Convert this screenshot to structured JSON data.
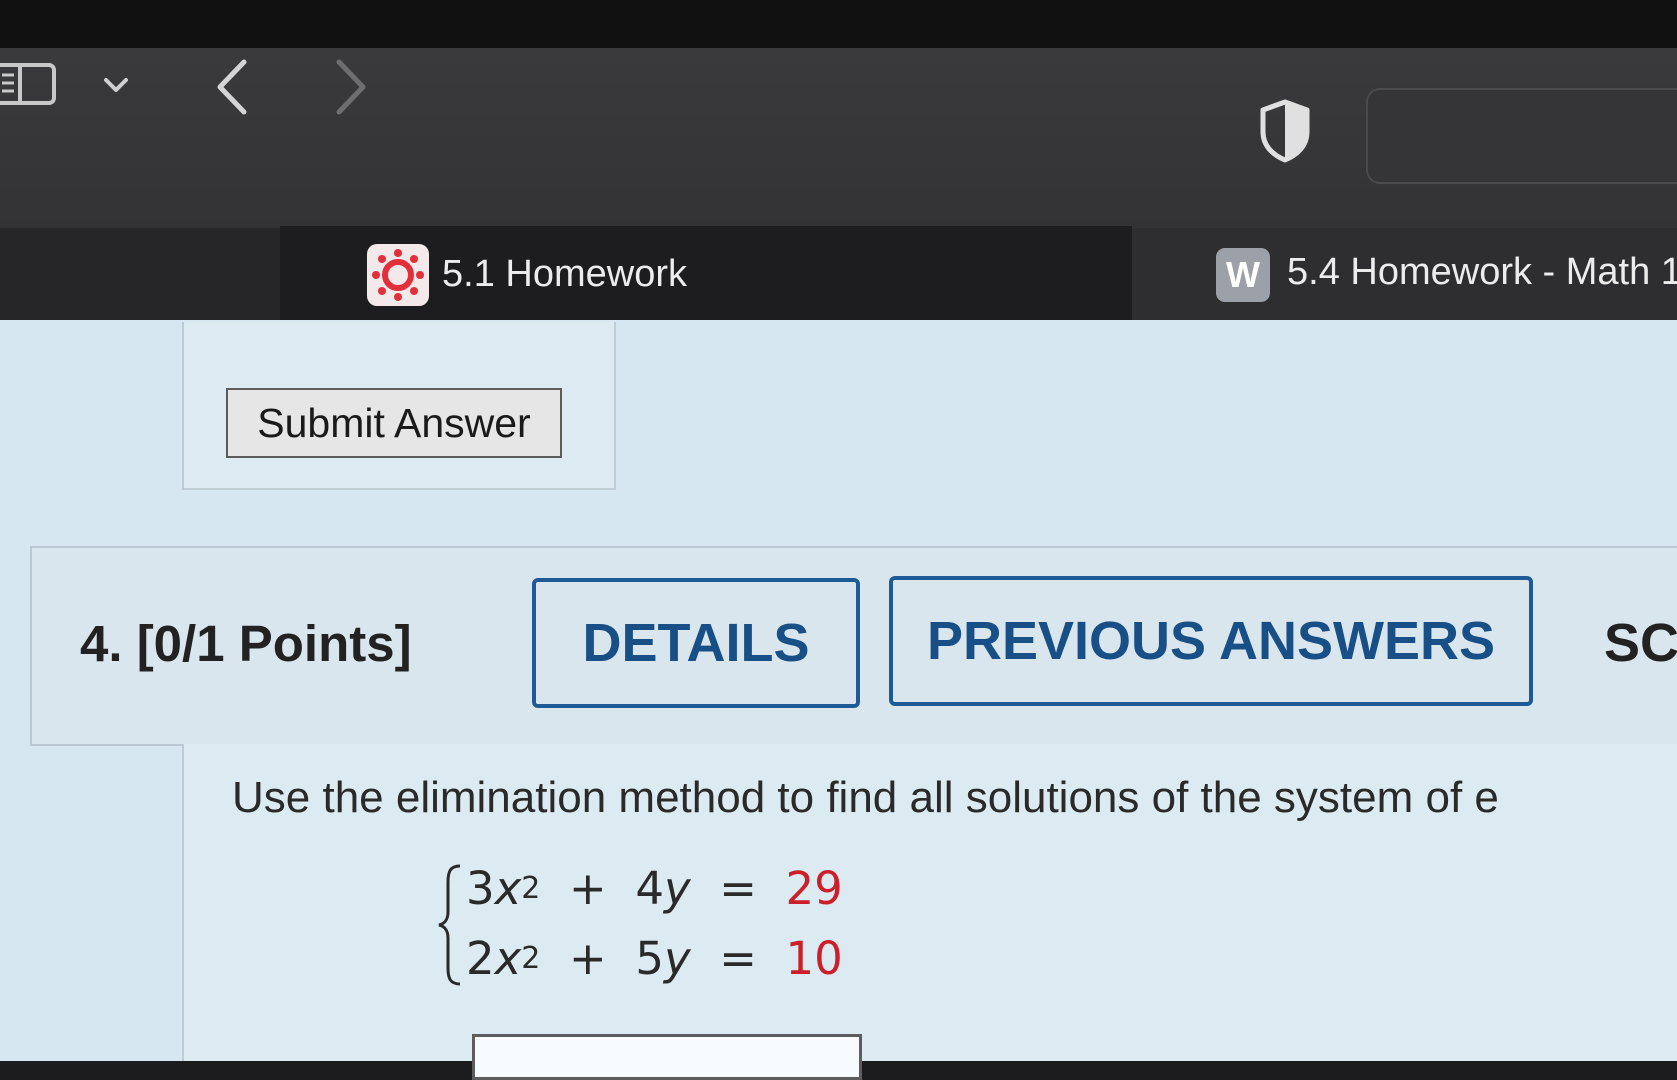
{
  "browser": {
    "tabs": [
      {
        "label": "5.1 Homework",
        "favicon": "canvas-logo-icon",
        "active": true
      },
      {
        "label": "5.4 Homework - Math 1",
        "favicon": "w-logo-icon",
        "favicon_letter": "W",
        "active": false
      }
    ],
    "icons": {
      "sidebar": "sidebar-toggle-icon",
      "tab_overview": "chevron-down-icon",
      "back": "chevron-left-icon",
      "forward": "chevron-right-icon",
      "privacy": "shield-icon"
    }
  },
  "assignment": {
    "submit_label": "Submit Answer",
    "question": {
      "number_points": "4.  [0/1 Points]",
      "details_label": "DETAILS",
      "previous_answers_label": "PREVIOUS ANSWERS",
      "next_tab_partial": "SC",
      "prompt": "Use the elimination method to find all solutions of the system of e",
      "equations": [
        {
          "coef_x": "3",
          "var_x": "x",
          "exp": "2",
          "op": "+",
          "coef_y": "4",
          "var_y": "y",
          "eq": "=",
          "rhs": "29"
        },
        {
          "coef_x": "2",
          "var_x": "x",
          "exp": "2",
          "op": "+",
          "coef_y": "5",
          "var_y": "y",
          "eq": "=",
          "rhs": "10"
        }
      ]
    }
  },
  "colors": {
    "accent": "#1e5a95",
    "rhs_highlight": "#cc1f2a",
    "page_bg": "#d6e7f1"
  }
}
